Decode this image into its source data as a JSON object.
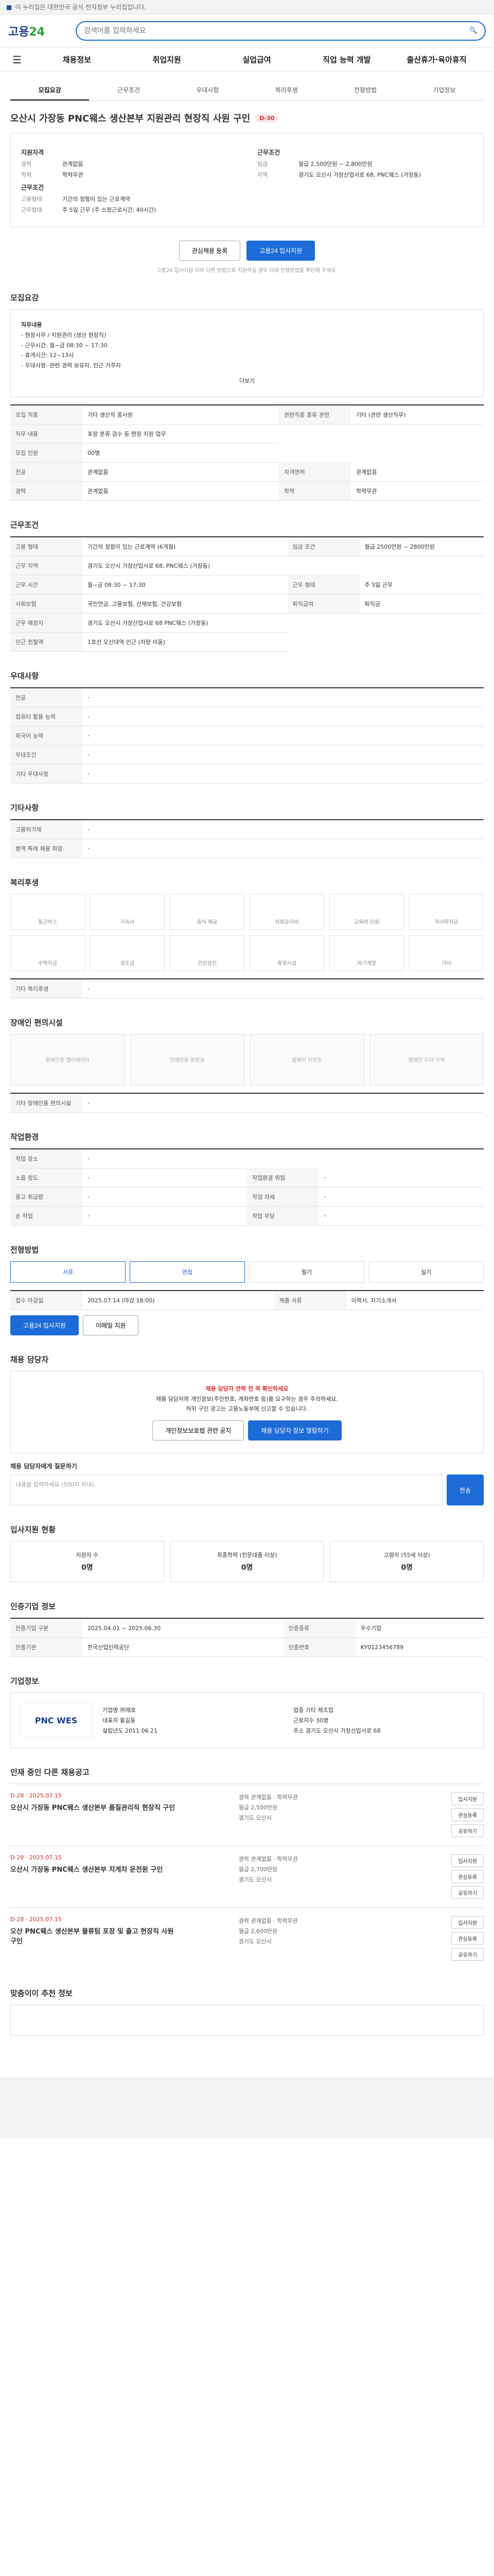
{
  "topbar": {
    "gov": "이 누리집은 대한민국 공식 전자정부 누리집입니다."
  },
  "header": {
    "logo_a": "고용",
    "logo_b": "24",
    "search_placeholder": "검색어를 입력하세요"
  },
  "gnb": [
    "채용정보",
    "취업지원",
    "실업급여",
    "직업 능력 개발",
    "출산휴가·육아휴직"
  ],
  "tabs": [
    "모집요강",
    "근무조건",
    "우대사항",
    "복리후생",
    "전형방법",
    "기업정보"
  ],
  "job": {
    "company": "㈜재호",
    "title": "오산시 가장동 PNC웨스 생산본부 지원관리 현장직 사원 구인",
    "dday": "D-30",
    "summary": {
      "left_h": "지원자격",
      "career_k": "경력",
      "career_v": "관계없음",
      "edu_k": "학력",
      "edu_v": "학력무관",
      "cond_h": "근무조건",
      "type_k": "고용형태",
      "type_v": "기간의 정함이 있는 근로계약",
      "time_k": "근무형태",
      "time_v": "주 5일 근무 (주 소정근로시간: 40시간)",
      "right_h": "근무조건",
      "pay_k": "임금",
      "pay_v": "월급 2,500만원 ~ 2,800만원",
      "place_k": "지역",
      "place_v": "경기도 오산시 가장산업서로 68, PNC웨스 (가장동)"
    },
    "btn_save": "관심채용 등록",
    "btn_apply": "고용24 입사지원",
    "apply_note": "고용24 입사지원 이외 다른 방법으로 지원하실 경우 아래 전형방법을 확인해 주세요."
  },
  "sections": {
    "recruit": "모집요강",
    "conditions": "근무조건",
    "preference": "우대사항",
    "etc": "기타사항",
    "welfare": "복리후생",
    "disabled": "장애인 편의시설",
    "facility": "작업환경",
    "method": "전형방법",
    "manager": "채용 담당자",
    "inquiry": "입사지원 현황",
    "stats": "인증기업 정보",
    "company": "기업정보",
    "others": "인재 중인 다른 채용공고",
    "recommend": "맞춤이이 추천 정보"
  },
  "recruit": {
    "desc_h": "직무내용",
    "desc": "- 현장사무 / 지원관리 (생산 현장직)\n- 근무시간: 월~금 08:30 ~ 17:30\n- 휴게시간: 12~13시\n- 우대사항: 관련 경력 보유자, 인근 거주자",
    "more": "더보기",
    "rows": [
      [
        "모집 직종",
        "기타 생산직 종사원",
        "관련직종 종류 관련",
        "기타 (관련 생산직무)"
      ],
      [
        "직무 내용",
        "포장 분류 검수 등 현장 지원 업무",
        "",
        ""
      ],
      [
        "모집 인원",
        "00명",
        "",
        ""
      ],
      [
        "전공",
        "관계없음",
        "자격면허",
        "관계없음"
      ],
      [
        "경력",
        "관계없음",
        "학력",
        "학력무관"
      ]
    ]
  },
  "conditions": {
    "rows": [
      [
        "고용 형태",
        "기간의 정함이 있는 근로계약 (6개월)",
        "임금 조건",
        "월급 2500만원 ~ 2800만원"
      ],
      [
        "근무 지역",
        "경기도 오산시 가장산업서로 68, PNC웨스 (가장동)",
        "",
        ""
      ],
      [
        "근무 시간",
        "월~금 08:30 ~ 17:30",
        "근무 형태",
        "주 5일 근무"
      ],
      [
        "사회보험",
        "국민연금, 고용보험, 산재보험, 건강보험",
        "퇴직급여",
        "퇴직금"
      ],
      [
        "근무 예정지",
        "경기도 오산시 가장산업서로 68 PNC웨스 (가장동)",
        "",
        ""
      ],
      [
        "인근 전철역",
        "1호선 오산대역 인근 (차량 이동)",
        "",
        ""
      ]
    ]
  },
  "preference": {
    "rows": [
      [
        "전공",
        "-"
      ],
      [
        "컴퓨터 활용 능력",
        "-"
      ],
      [
        "외국어 능력",
        "-"
      ],
      [
        "우대조건",
        "-"
      ],
      [
        "기타 우대사항",
        "-"
      ]
    ]
  },
  "etc": {
    "rows": [
      [
        "고용허가제",
        "-"
      ],
      [
        "병역 특례 채용 희망",
        "-"
      ]
    ]
  },
  "welfare": {
    "items": [
      "통근버스",
      "기숙사",
      "중식 제공",
      "차량유지비",
      "교육비 지원",
      "자녀학자금",
      "주택자금",
      "경조금",
      "건강검진",
      "휴양시설",
      "자기계발",
      "기타"
    ],
    "etc_k": "기타 복리후생",
    "etc_v": "-"
  },
  "disabled": {
    "items": [
      "장애인용 엘리베이터",
      "장애인용 화장실",
      "휠체어 리프트",
      "장애인 주차 구역"
    ],
    "etc_k": "기타 장애인용 편의시설",
    "etc_v": "-"
  },
  "facility": {
    "rows": [
      [
        "작업 장소",
        "-",
        "",
        ""
      ],
      [
        "소음 정도",
        "-",
        "작업환경 위험",
        "-"
      ],
      [
        "중고 취급량",
        "-",
        "작업 자세",
        "-"
      ],
      [
        "손 작업",
        "-",
        "작업 부담",
        "-"
      ]
    ]
  },
  "method": {
    "types": [
      "서류",
      "면접",
      "필기",
      "실기"
    ],
    "rows": [
      [
        "접수 마감일",
        "2025.07.14 (마감 18:00)",
        "제출 서류",
        "이력서, 자기소개서"
      ]
    ],
    "btn_apply": "고용24 입사지원",
    "btn_email": "이메일 지원"
  },
  "manager": {
    "alert_title": "채용 담당자 연락 전 꼭 확인하세요",
    "alert_1": "채용 담당자와 개인정보(주민번호, 계좌번호 등)를 요구하는 경우 주의하세요.",
    "alert_2": "허위 구인 광고는 고용노동부에 신고할 수 있습니다.",
    "btn_check": "개인정보보호법 관련 공지",
    "btn_show": "채용 담당자 정보 열람하기",
    "inquiry_label": "채용 담당자에게 질문하기",
    "inquiry_placeholder": "내용을 입력하세요 (500자 이내)",
    "btn_send": "전송"
  },
  "applystats": {
    "items": [
      [
        "지원자 수",
        "0명"
      ],
      [
        "최종학력 (전문대졸 이상)",
        "0명"
      ],
      [
        "고령자 (55세 이상)",
        "0명"
      ]
    ]
  },
  "certinfo": {
    "rows": [
      [
        "인증기업 구분",
        "2025.04.01 ~ 2025.06.30",
        "인증종류",
        "우수기업"
      ],
      [
        "인증기관",
        "한국산업인력공단",
        "인증번호",
        "KY0123456789"
      ]
    ]
  },
  "company": {
    "logo": "PNC WES",
    "info": [
      [
        "기업명",
        "㈜재호"
      ],
      [
        "업종",
        "기타 제조업"
      ],
      [
        "대표자",
        "홍길동"
      ],
      [
        "근로자수",
        "30명"
      ],
      [
        "설립년도",
        "2011.06.21"
      ],
      [
        "주소",
        "경기도 오산시 가장산업서로 68"
      ]
    ]
  },
  "others": [
    {
      "dday": "D-28 · 2025.07.15",
      "title": "오산시 가장동 PNC웨스 생산본부 품질관리직 현장직 구인",
      "m1": "경력 관계없음 · 학력무관",
      "m2": "월급 2,500만원",
      "m3": "경기도 오산시"
    },
    {
      "dday": "D-28 · 2025.07.15",
      "title": "오산시 가장동 PNC웨스 생산본부 지게차 운전원 구인",
      "m1": "경력 관계없음 · 학력무관",
      "m2": "월급 2,700만원",
      "m3": "경기도 오산시"
    },
    {
      "dday": "D-28 · 2025.07.15",
      "title": "오산 PNC웨스 생산본부 물류팀 포장 및 출고 현장직 사원 구인",
      "m1": "경력 관계없음 · 학력무관",
      "m2": "월급 2,600만원",
      "m3": "경기도 오산시"
    }
  ],
  "other_btns": [
    "입사지원",
    "관심등록",
    "공유하기"
  ]
}
